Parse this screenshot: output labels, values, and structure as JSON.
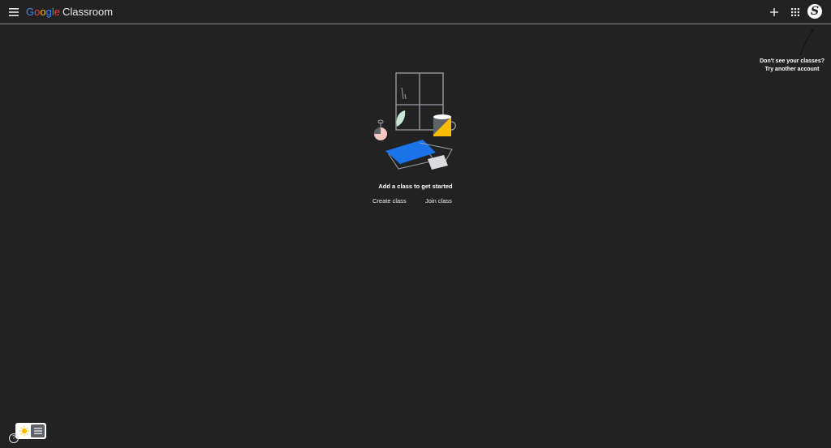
{
  "app": {
    "logo_parts": [
      "G",
      "o",
      "o",
      "g",
      "l",
      "e"
    ],
    "product_name": "Classroom"
  },
  "header": {
    "menu_icon": "hamburger-menu-icon",
    "create_icon": "plus-icon",
    "apps_icon": "apps-grid-icon",
    "avatar_initial": "S"
  },
  "account_hint": {
    "line1": "Don't see your classes?",
    "line2": "Try another account"
  },
  "empty_state": {
    "message": "Add a class to get started",
    "create_label": "Create class",
    "join_label": "Join class"
  },
  "footer": {
    "help_label": "?",
    "theme_toggle_icons": [
      "sun-icon",
      "document-icon"
    ]
  },
  "colors": {
    "background": "#222222",
    "google_blue": "#4285f4",
    "google_red": "#ea4335",
    "google_yellow": "#fbbc05",
    "google_green": "#34a853",
    "text": "#e8eaed"
  }
}
